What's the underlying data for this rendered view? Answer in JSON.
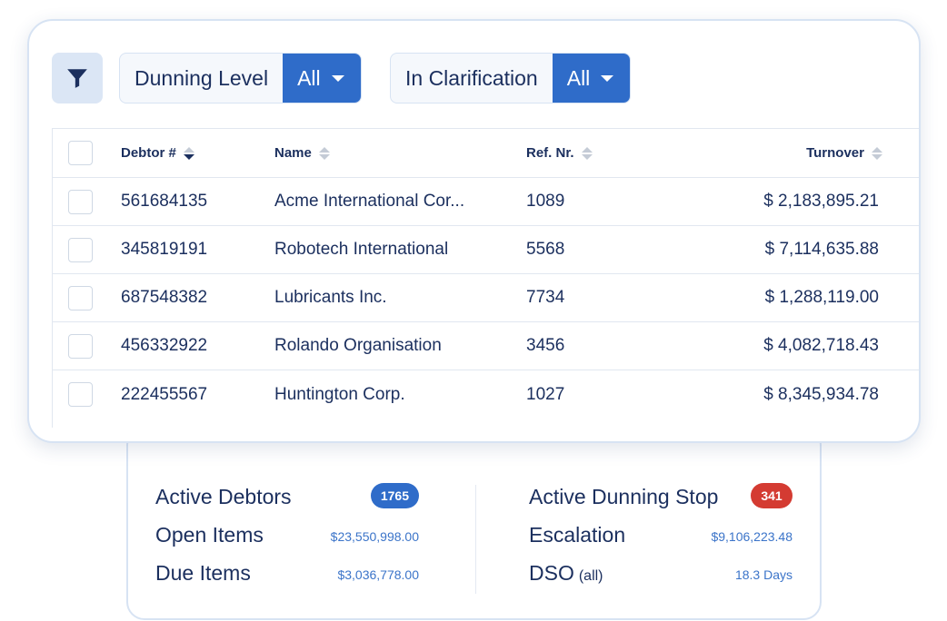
{
  "filters": {
    "icon": "funnel-icon",
    "dunning_level": {
      "label": "Dunning Level",
      "value": "All"
    },
    "in_clarification": {
      "label": "In Clarification",
      "value": "All"
    }
  },
  "table": {
    "columns": {
      "debtor": "Debtor #",
      "name": "Name",
      "ref": "Ref. Nr.",
      "turnover": "Turnover"
    },
    "sorted_column": "debtor",
    "rows": [
      {
        "debtor": "561684135",
        "name": "Acme International Cor...",
        "ref": "1089",
        "turnover": "$ 2,183,895.21"
      },
      {
        "debtor": "345819191",
        "name": "Robotech International",
        "ref": "5568",
        "turnover": "$ 7,114,635.88"
      },
      {
        "debtor": "687548382",
        "name": "Lubricants Inc.",
        "ref": "7734",
        "turnover": "$ 1,288,119.00"
      },
      {
        "debtor": "456332922",
        "name": "Rolando Organisation",
        "ref": "3456",
        "turnover": "$ 4,082,718.43"
      },
      {
        "debtor": "222455567",
        "name": "Huntington Corp.",
        "ref": "1027",
        "turnover": "$ 8,345,934.78"
      }
    ]
  },
  "stats": {
    "active_debtors": {
      "label": "Active Debtors",
      "badge": "1765"
    },
    "open_items": {
      "label": "Open Items",
      "value": "$23,550,998.00"
    },
    "due_items": {
      "label": "Due Items",
      "value": "$3,036,778.00"
    },
    "active_dunning_stop": {
      "label": "Active Dunning Stop",
      "badge": "341"
    },
    "escalation": {
      "label": "Escalation",
      "value": "$9,106,223.48"
    },
    "dso": {
      "label": "DSO",
      "suffix": "(all)",
      "value": "18.3 Days"
    }
  },
  "colors": {
    "accent": "#2f6cc9",
    "danger": "#d43b32",
    "text": "#1b2f5e",
    "link_value": "#3b74c9"
  }
}
